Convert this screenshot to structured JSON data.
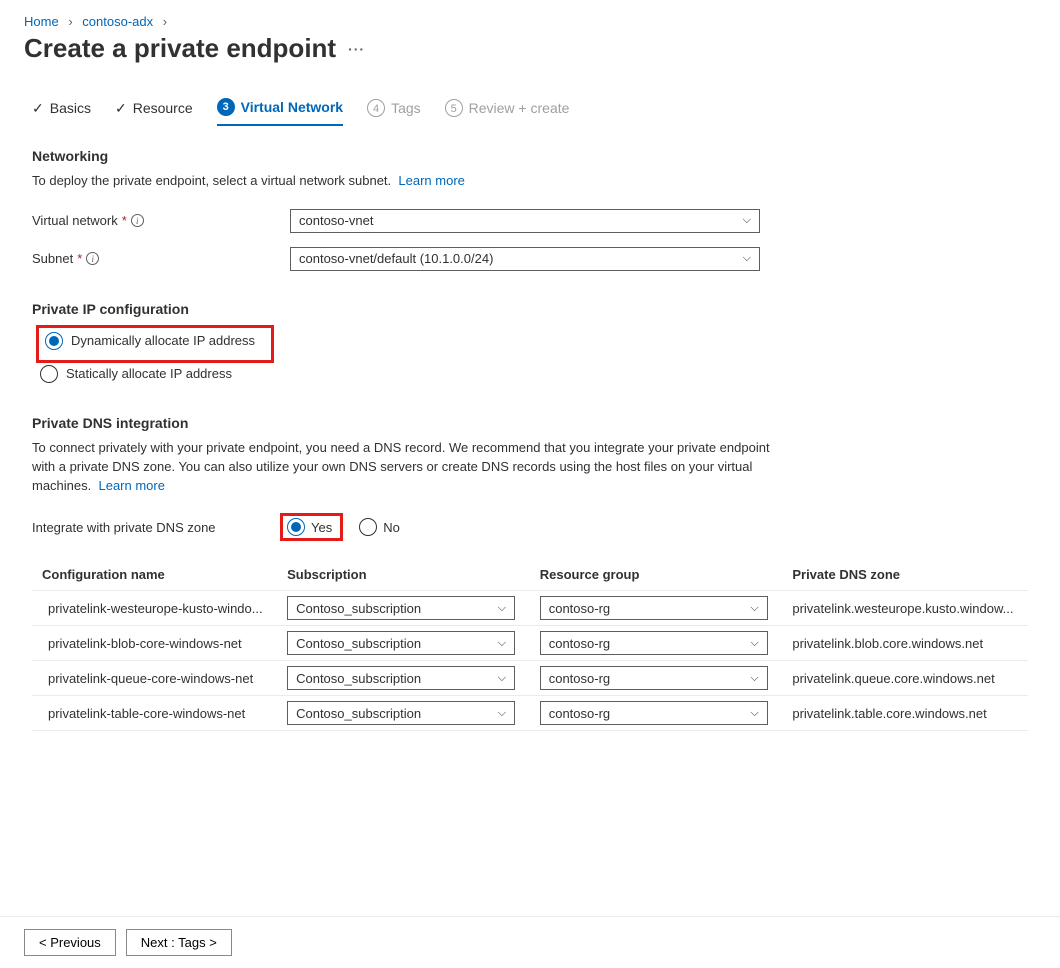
{
  "breadcrumb": {
    "home": "Home",
    "cluster": "contoso-adx"
  },
  "title": "Create a private endpoint",
  "tabs": {
    "basics": "Basics",
    "resource": "Resource",
    "vnet": "Virtual Network",
    "tags_num": "4",
    "tags": "Tags",
    "review_num": "5",
    "review": "Review + create"
  },
  "networking": {
    "head": "Networking",
    "desc": "To deploy the private endpoint, select a virtual network subnet.",
    "learn": "Learn more",
    "vnet_label": "Virtual network",
    "vnet_value": "contoso-vnet",
    "subnet_label": "Subnet",
    "subnet_value": "contoso-vnet/default (10.1.0.0/24)"
  },
  "ipconfig": {
    "head": "Private IP configuration",
    "dyn": "Dynamically allocate IP address",
    "stat": "Statically allocate IP address"
  },
  "dns": {
    "head": "Private DNS integration",
    "desc": "To connect privately with your private endpoint, you need a DNS record. We recommend that you integrate your private endpoint with a private DNS zone. You can also utilize your own DNS servers or create DNS records using the host files on your virtual machines.",
    "learn": "Learn more",
    "integrate_label": "Integrate with private DNS zone",
    "yes": "Yes",
    "no": "No"
  },
  "table": {
    "h1": "Configuration name",
    "h2": "Subscription",
    "h3": "Resource group",
    "h4": "Private DNS zone",
    "rows": [
      {
        "name": "privatelink-westeurope-kusto-windo...",
        "sub": "Contoso_subscription",
        "rg": "contoso-rg",
        "zone": "privatelink.westeurope.kusto.window..."
      },
      {
        "name": "privatelink-blob-core-windows-net",
        "sub": "Contoso_subscription",
        "rg": "contoso-rg",
        "zone": "privatelink.blob.core.windows.net"
      },
      {
        "name": "privatelink-queue-core-windows-net",
        "sub": "Contoso_subscription",
        "rg": "contoso-rg",
        "zone": "privatelink.queue.core.windows.net"
      },
      {
        "name": "privatelink-table-core-windows-net",
        "sub": "Contoso_subscription",
        "rg": "contoso-rg",
        "zone": "privatelink.table.core.windows.net"
      }
    ]
  },
  "footer": {
    "prev": "<  Previous",
    "next": "Next : Tags  >"
  }
}
